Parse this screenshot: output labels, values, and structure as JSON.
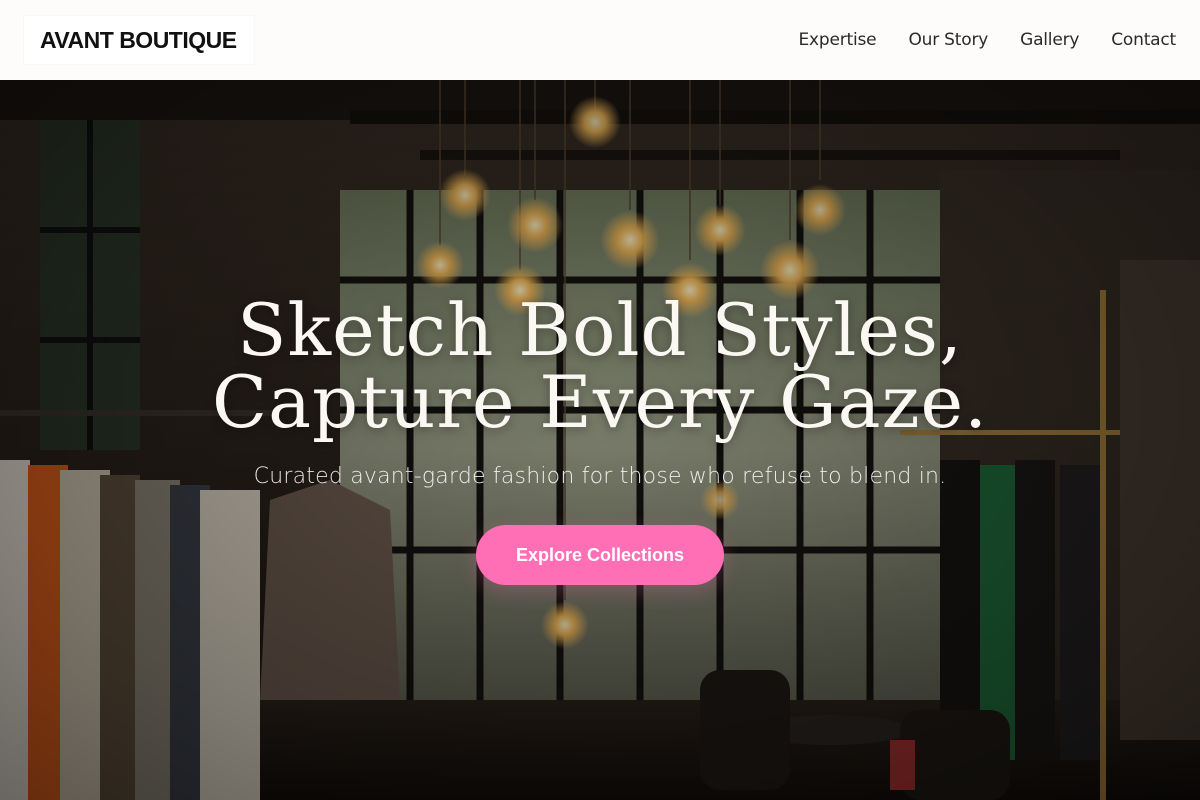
{
  "brand": {
    "name": "AVANT BOUTIQUE"
  },
  "nav": {
    "items": [
      {
        "label": "Expertise"
      },
      {
        "label": "Our Story"
      },
      {
        "label": "Gallery"
      },
      {
        "label": "Contact"
      }
    ]
  },
  "hero": {
    "title_line1": "Sketch Bold Styles,",
    "title_line2": "Capture Every Gaze.",
    "subtitle": "Curated avant-garde fashion for those who refuse to blend in.",
    "cta_label": "Explore Collections",
    "cta_color": "#ff6fb5",
    "background_description_icon": "boutique-interior-image"
  }
}
